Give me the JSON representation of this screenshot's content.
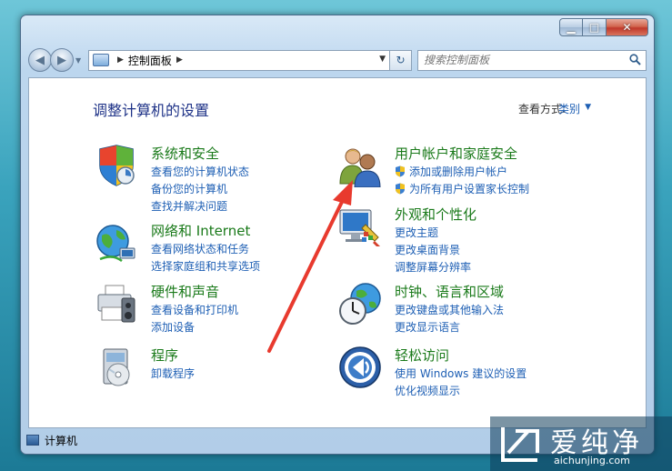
{
  "window": {
    "address": {
      "crumb": "控制面板"
    },
    "search_placeholder": "搜索控制面板"
  },
  "page": {
    "heading": "调整计算机的设置",
    "view_by_label": "查看方式:",
    "view_by_value": "类别"
  },
  "categories": [
    {
      "title": "系统和安全",
      "icon": "shield-icon",
      "links": [
        "查看您的计算机状态",
        "备份您的计算机",
        "查找并解决问题"
      ]
    },
    {
      "title": "网络和 Internet",
      "icon": "network-globe-icon",
      "links": [
        "查看网络状态和任务",
        "选择家庭组和共享选项"
      ]
    },
    {
      "title": "硬件和声音",
      "icon": "printer-icon",
      "links": [
        "查看设备和打印机",
        "添加设备"
      ]
    },
    {
      "title": "程序",
      "icon": "programs-icon",
      "links": [
        "卸载程序"
      ]
    },
    {
      "title": "用户帐户和家庭安全",
      "icon": "users-icon",
      "links": [
        "添加或删除用户帐户",
        "为所有用户设置家长控制"
      ]
    },
    {
      "title": "外观和个性化",
      "icon": "monitor-paint-icon",
      "links": [
        "更改主题",
        "更改桌面背景",
        "调整屏幕分辨率"
      ]
    },
    {
      "title": "时钟、语言和区域",
      "icon": "clock-globe-icon",
      "links": [
        "更改键盘或其他输入法",
        "更改显示语言"
      ]
    },
    {
      "title": "轻松访问",
      "icon": "ease-of-access-icon",
      "links": [
        "使用 Windows 建议的设置",
        "优化视频显示"
      ]
    }
  ],
  "status_bar": {
    "text": "计算机"
  },
  "watermark": {
    "big": "爱纯净",
    "small": "aichunjing.com"
  },
  "colors": {
    "link": "#1e5fb4",
    "category_title": "#1a7a1a",
    "heading": "#1e3287",
    "arrow": "#e83a2e"
  }
}
